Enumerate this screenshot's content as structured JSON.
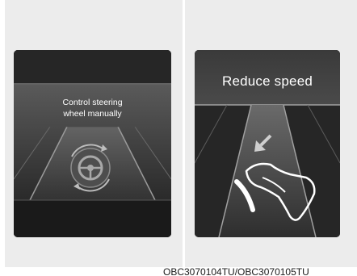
{
  "left_display": {
    "message_line1": "Control steering",
    "message_line2": "wheel manually",
    "icon": "steering-wheel-icon"
  },
  "right_display": {
    "message": "Reduce speed",
    "icon": "foot-on-brake-pedal-icon"
  },
  "caption": "OBC3070104TU/OBC3070105TU",
  "colors": {
    "background": "#ececec",
    "screen": "#1f1f1f",
    "text": "#ffffff"
  }
}
